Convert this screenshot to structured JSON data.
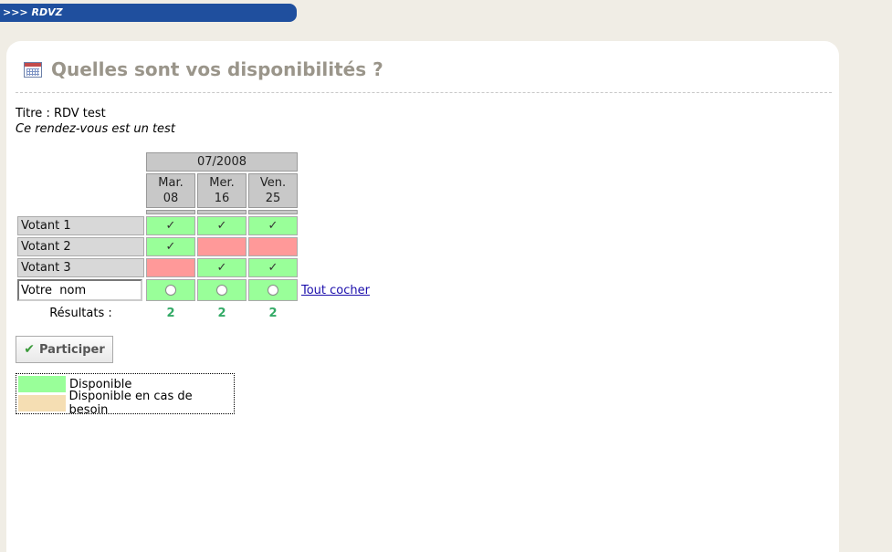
{
  "topbar": {
    "label": ">>> RDVZ"
  },
  "heading": {
    "title": "Quelles sont vos disponibilités ?"
  },
  "info": {
    "titre": "Titre : RDV test",
    "description": "Ce rendez-vous est un test"
  },
  "poll": {
    "month": "07/2008",
    "days": [
      {
        "weekday": "Mar.",
        "day": "08"
      },
      {
        "weekday": "Mer.",
        "day": "16"
      },
      {
        "weekday": "Ven.",
        "day": "25"
      }
    ],
    "voters": [
      {
        "name": "Votant 1",
        "answers": [
          "yes",
          "yes",
          "yes"
        ]
      },
      {
        "name": "Votant 2",
        "answers": [
          "yes",
          "no",
          "no"
        ]
      },
      {
        "name": "Votant 3",
        "answers": [
          "no",
          "yes",
          "yes"
        ]
      }
    ],
    "name_input_value": "Votre  nom",
    "tout_cocher": "Tout cocher",
    "results_label": "Résultats :",
    "results": [
      "2",
      "2",
      "2"
    ],
    "check_glyph": "✓"
  },
  "participer_label": "Participer",
  "legend": {
    "items": [
      {
        "label": "Disponible",
        "color": "#99ff99"
      },
      {
        "label": "Disponible en cas de besoin",
        "color": "#f5deb3"
      }
    ]
  },
  "colors": {
    "yes": "#99ff99",
    "no": "#ff9999",
    "header": "#c8c8c8",
    "topbar": "#1f4f9e",
    "title": "#9a958a"
  }
}
